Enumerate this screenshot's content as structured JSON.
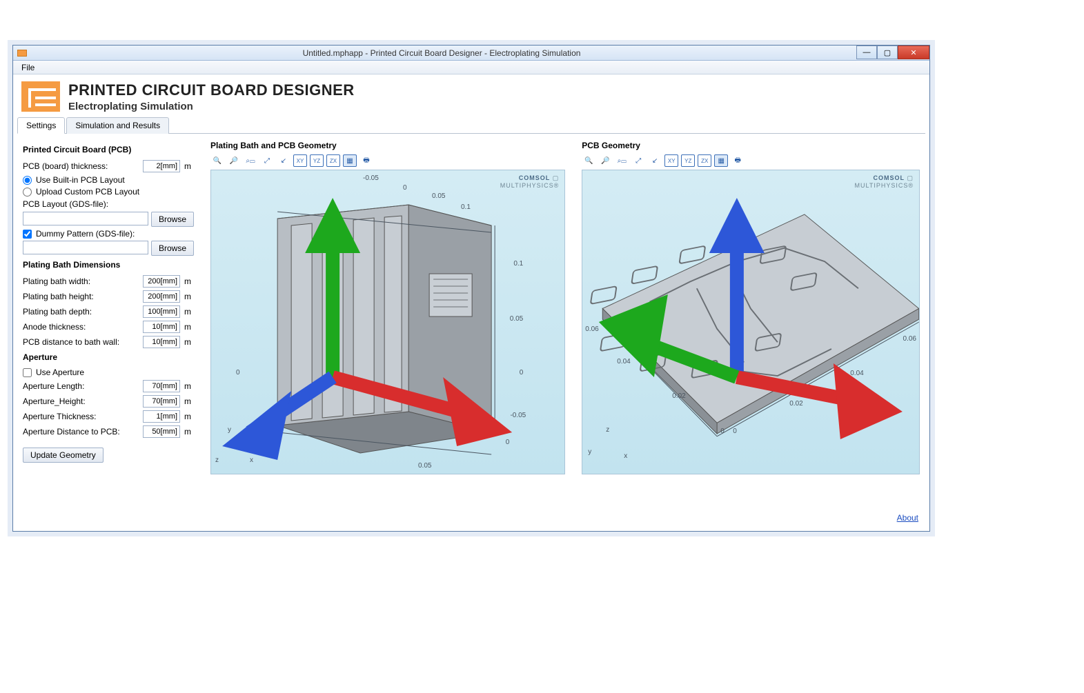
{
  "window": {
    "title": "Untitled.mphapp - Printed Circuit Board Designer - Electroplating Simulation"
  },
  "menubar": {
    "file": "File"
  },
  "header": {
    "title": "PRINTED CIRCUIT BOARD DESIGNER",
    "subtitle": "Electroplating Simulation"
  },
  "tabs": {
    "settings": "Settings",
    "results": "Simulation and Results"
  },
  "settings": {
    "pcb_section": "Printed Circuit Board (PCB)",
    "pcb_thickness_label": "PCB (board) thickness:",
    "pcb_thickness_value": "2[mm]",
    "pcb_thickness_unit": "m",
    "use_builtin_label": "Use Built-in PCB Layout",
    "upload_custom_label": "Upload Custom PCB Layout",
    "layout_file_label": "PCB Layout (GDS-file):",
    "browse": "Browse",
    "dummy_pattern_label": "Dummy Pattern (GDS-file):",
    "bath_section": "Plating Bath Dimensions",
    "bath_width_label": "Plating bath width:",
    "bath_width_value": "200[mm]",
    "bath_height_label": "Plating bath height:",
    "bath_height_value": "200[mm]",
    "bath_depth_label": "Plating bath depth:",
    "bath_depth_value": "100[mm]",
    "anode_thickness_label": "Anode thickness:",
    "anode_thickness_value": "10[mm]",
    "pcb_dist_label": "PCB distance to bath wall:",
    "pcb_dist_value": "10[mm]",
    "aperture_section": "Aperture",
    "use_aperture_label": "Use Aperture",
    "ap_length_label": "Aperture Length:",
    "ap_length_value": "70[mm]",
    "ap_height_label": "Aperture_Height:",
    "ap_height_value": "70[mm]",
    "ap_thickness_label": "Aperture Thickness:",
    "ap_thickness_value": "1[mm]",
    "ap_dist_label": "Aperture Distance to PCB:",
    "ap_dist_value": "50[mm]",
    "unit_m": "m",
    "update_btn": "Update Geometry"
  },
  "views": {
    "bath_title": "Plating Bath and PCB Geometry",
    "pcb_title": "PCB Geometry",
    "brand1": "COMSOL",
    "brand2": "MULTIPHYSICS",
    "toolbar": {
      "zoom_in": "zoom-in",
      "zoom_out": "zoom-out",
      "zoom_box": "zoom-box",
      "zoom_extents": "zoom-extents",
      "default3d": "default-3d",
      "xy": "XY",
      "yz": "YZ",
      "zx": "ZX",
      "image": "image-snapshot",
      "print": "print"
    },
    "bath_ticks": {
      "top_neg005": "-0.05",
      "top_0": "0",
      "top_005": "0.05",
      "top_01": "0.1",
      "right_01": "0.1",
      "right_005": "0.05",
      "right_0": "0",
      "right_neg005": "-0.05",
      "bottom_0": "0",
      "bottom_005": "0.05",
      "depth_0": "0"
    },
    "pcb_ticks": {
      "y_006": "0.06",
      "y_004": "0.04",
      "y_002": "0.02",
      "x_0a": "0",
      "x_0b": "0",
      "x_002": "0.02",
      "x_004": "0.04",
      "x_006": "0.06"
    },
    "axis_bath": {
      "x": "x",
      "y": "y",
      "z": "z"
    },
    "axis_pcb": {
      "x": "x",
      "y": "y",
      "z": "z"
    }
  },
  "footer": {
    "about": "About"
  }
}
